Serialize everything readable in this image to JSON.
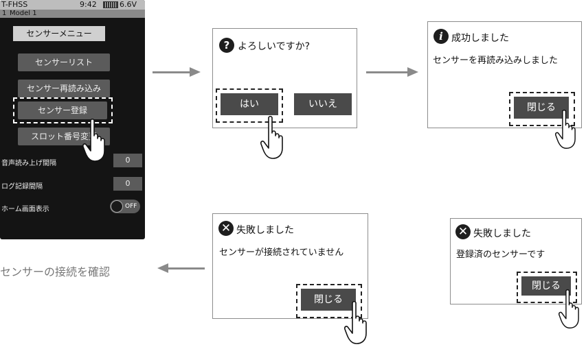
{
  "device": {
    "status": {
      "model_code": "T-FHSS",
      "time": "9:42",
      "voltage": "6.6V"
    },
    "model": {
      "number": "1",
      "name": "Model 1"
    },
    "menu_title": "センサーメニュー",
    "buttons": {
      "sensor_list": "センサーリスト",
      "sensor_reload": "センサー再読み込み",
      "sensor_register": "センサー登録",
      "slot_number": "スロット番号変更"
    },
    "settings": [
      {
        "label": "音声読み上げ間隔",
        "value": "0"
      },
      {
        "label": "ログ記録間隔",
        "value": "0"
      },
      {
        "label": "ホーム画面表示",
        "value": "OFF"
      }
    ]
  },
  "dialogs": {
    "confirm": {
      "question": "よろしいですか?",
      "yes": "はい",
      "no": "いいえ"
    },
    "success": {
      "title": "成功しました",
      "message": "センサーを再読み込みしました",
      "close": "閉じる"
    },
    "fail_connection": {
      "title": "失敗しました",
      "message": "センサーが接続されていません",
      "close": "閉じる"
    },
    "fail_registered": {
      "title": "失敗しました",
      "message": "登録済のセンサーです",
      "close": "閉じる"
    }
  },
  "caption": "センサーの接続を確認",
  "icons": {
    "question": "question-icon",
    "info": "info-icon",
    "error": "error-x-icon",
    "hand": "pointing-hand-icon"
  },
  "colors": {
    "screen_bg": "#141414",
    "button_bg": "#5b5b5b",
    "dialog_button_bg": "#4a4a4a",
    "arrow": "#8a8a8a"
  }
}
